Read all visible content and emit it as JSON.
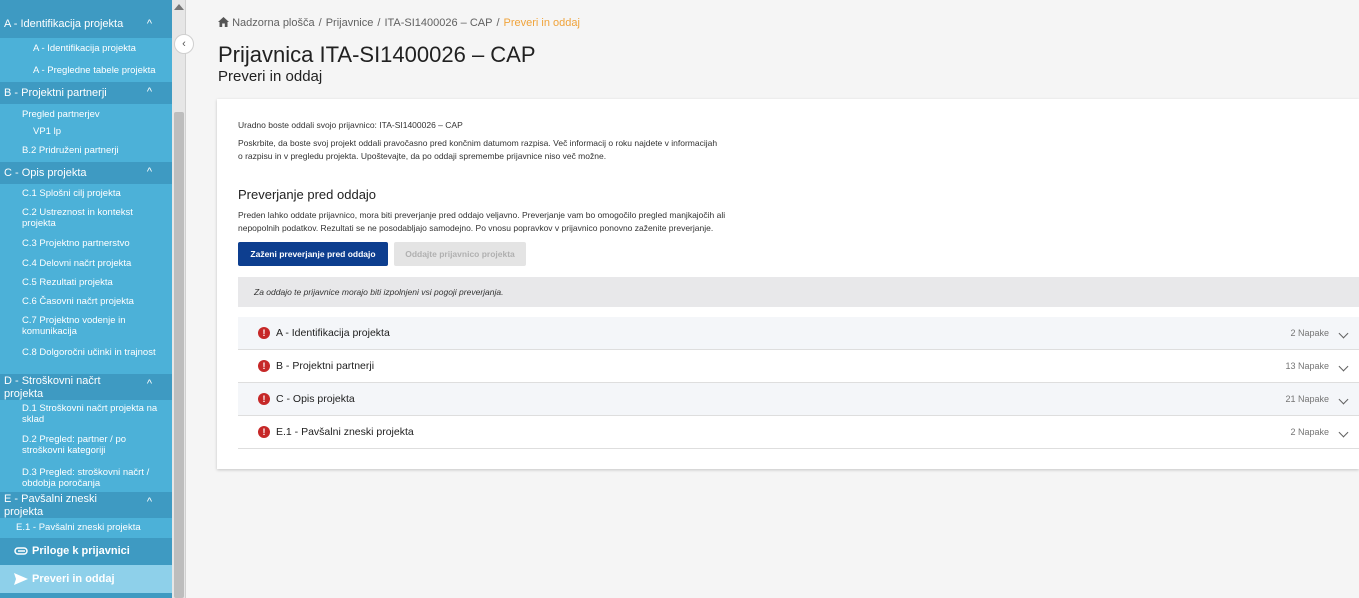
{
  "sidebar": {
    "sections": [
      {
        "title": "A - Identifikacija projekta",
        "items": [
          "A - Identifikacija projekta",
          "A - Pregledne tabele projekta"
        ]
      },
      {
        "title": "B - Projektni partnerji",
        "items": [
          "Pregled partnerjev",
          "VP1 lp",
          "B.2 Pridruženi partnerji"
        ]
      },
      {
        "title": "C - Opis projekta",
        "items": [
          "C.1 Splošni cilj projekta",
          "C.2 Ustreznost in kontekst projekta",
          "C.3 Projektno partnerstvo",
          "C.4 Delovni načrt projekta",
          "C.5 Rezultati projekta",
          "C.6 Časovni načrt projekta",
          "C.7 Projektno vodenje in komunikacija",
          "C.8 Dolgoročni učinki in trajnost"
        ]
      },
      {
        "title": "D - Stroškovni načrt projekta",
        "items": [
          "D.1 Stroškovni načrt projekta na sklad",
          "D.2 Pregled: partner / po stroškovni kategoriji",
          "D.3 Pregled: stroškovni načrt / obdobja poročanja"
        ]
      },
      {
        "title": "E - Pavšalni zneski projekta",
        "items": [
          "E.1 - Pavšalni zneski projekta"
        ]
      }
    ],
    "attachments": "Priloge k prijavnici",
    "submit": "Preveri in oddaj"
  },
  "breadcrumb": {
    "items": [
      "Nadzorna plošča",
      "Prijavnice",
      "ITA-SI1400026 – CAP",
      "Preveri in oddaj"
    ],
    "sep": "/"
  },
  "page": {
    "title": "Prijavnica ITA-SI1400026 – CAP",
    "subtitle": "Preveri in oddaj"
  },
  "card": {
    "intro1": "Uradno boste oddali svojo prijavnico: ITA-SI1400026 – CAP",
    "intro2a": "Poskrbite, da boste svoj projekt oddali pravočasno pred končnim datumom razpisa. Več informacij o roku najdete v informacijah",
    "intro2b": "o razpisu in v pregledu projekta. Upoštevajte, da po oddaji spremembe prijavnice niso več možne.",
    "check_title": "Preverjanje pred oddajo",
    "check_text_a": "Preden lahko oddate prijavnico, mora biti preverjanje pred oddajo veljavno. Preverjanje vam bo omogočilo pregled manjkajočih ali",
    "check_text_b": "nepopolnih podatkov. Rezultati se ne posodabljajo samodejno. Po vnosu popravkov v prijavnico ponovno zaženite preverjanje.",
    "run_button": "Zaženi preverjanje pred oddajo",
    "submit_button": "Oddajte prijavnico projekta",
    "notice": "Za oddajo te prijavnice morajo biti izpolnjeni vsi pogoji preverjanja.",
    "errors": [
      {
        "label": "A - Identifikacija projekta",
        "count": "2 Napake"
      },
      {
        "label": "B - Projektni partnerji",
        "count": "13 Napake"
      },
      {
        "label": "C - Opis projekta",
        "count": "21 Napake"
      },
      {
        "label": "E.1 - Pavšalni zneski projekta",
        "count": "2 Napake"
      }
    ]
  },
  "icons": {
    "error": "!",
    "collapse": "‹",
    "home": "home-icon",
    "chevron": "^"
  },
  "colors": {
    "sidebar": "#3e9ac2",
    "sidebar_sub": "#4cb1d8",
    "primary_button": "#0d3e8f",
    "breadcrumb_current": "#f0a33a",
    "error": "#c62828"
  }
}
